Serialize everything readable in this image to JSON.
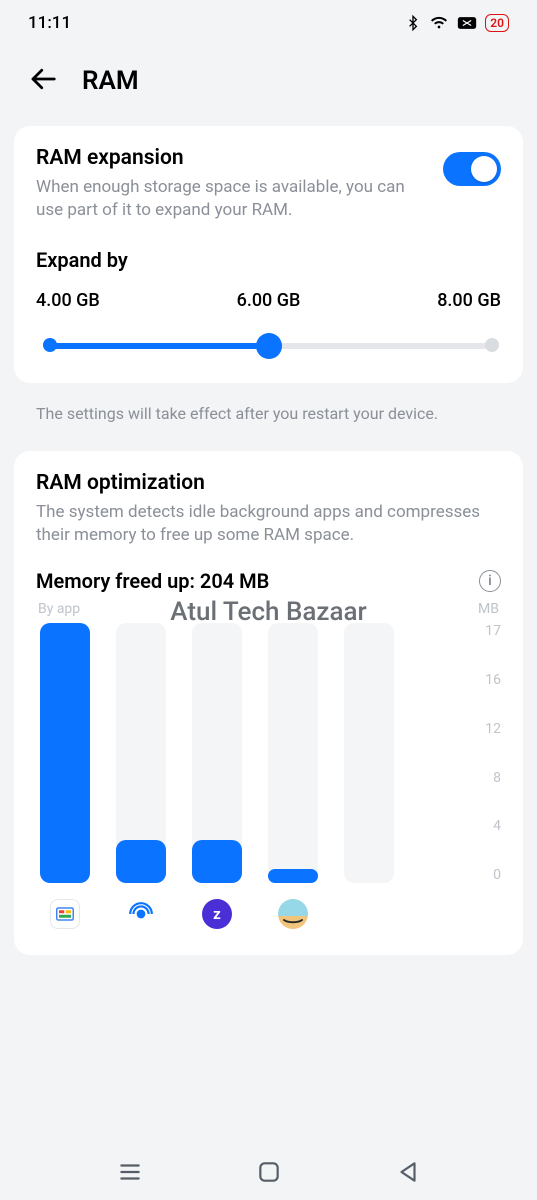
{
  "status": {
    "time": "11:11",
    "battery_pct": "20"
  },
  "header": {
    "title": "RAM"
  },
  "expansion": {
    "title": "RAM expansion",
    "desc": "When enough storage space is available, you can use part of it to expand your RAM.",
    "toggle_on": true,
    "expand_title": "Expand by",
    "options": [
      "4.00 GB",
      "6.00 GB",
      "8.00 GB"
    ],
    "selected_index": 1
  },
  "restart_note": "The settings will take effect after you restart your device.",
  "optimization": {
    "title": "RAM optimization",
    "desc": "The system detects idle background apps and compresses their memory to free up some RAM space.",
    "freed_label": "Memory freed up: 204 MB",
    "left_axis": "By app",
    "right_axis_unit": "MB"
  },
  "chart_data": {
    "type": "bar",
    "unit": "MB",
    "ylim": [
      0,
      18
    ],
    "ticks": [
      17,
      16,
      12,
      8,
      4,
      0
    ],
    "series": [
      {
        "name": "app-googletv",
        "value": 18
      },
      {
        "name": "app-podcast",
        "value": 3
      },
      {
        "name": "app-zepto",
        "value": 3
      },
      {
        "name": "app-amazon",
        "value": 1
      },
      {
        "name": "app-unknown",
        "value": 0
      }
    ]
  },
  "watermark": "Atul Tech Bazaar"
}
